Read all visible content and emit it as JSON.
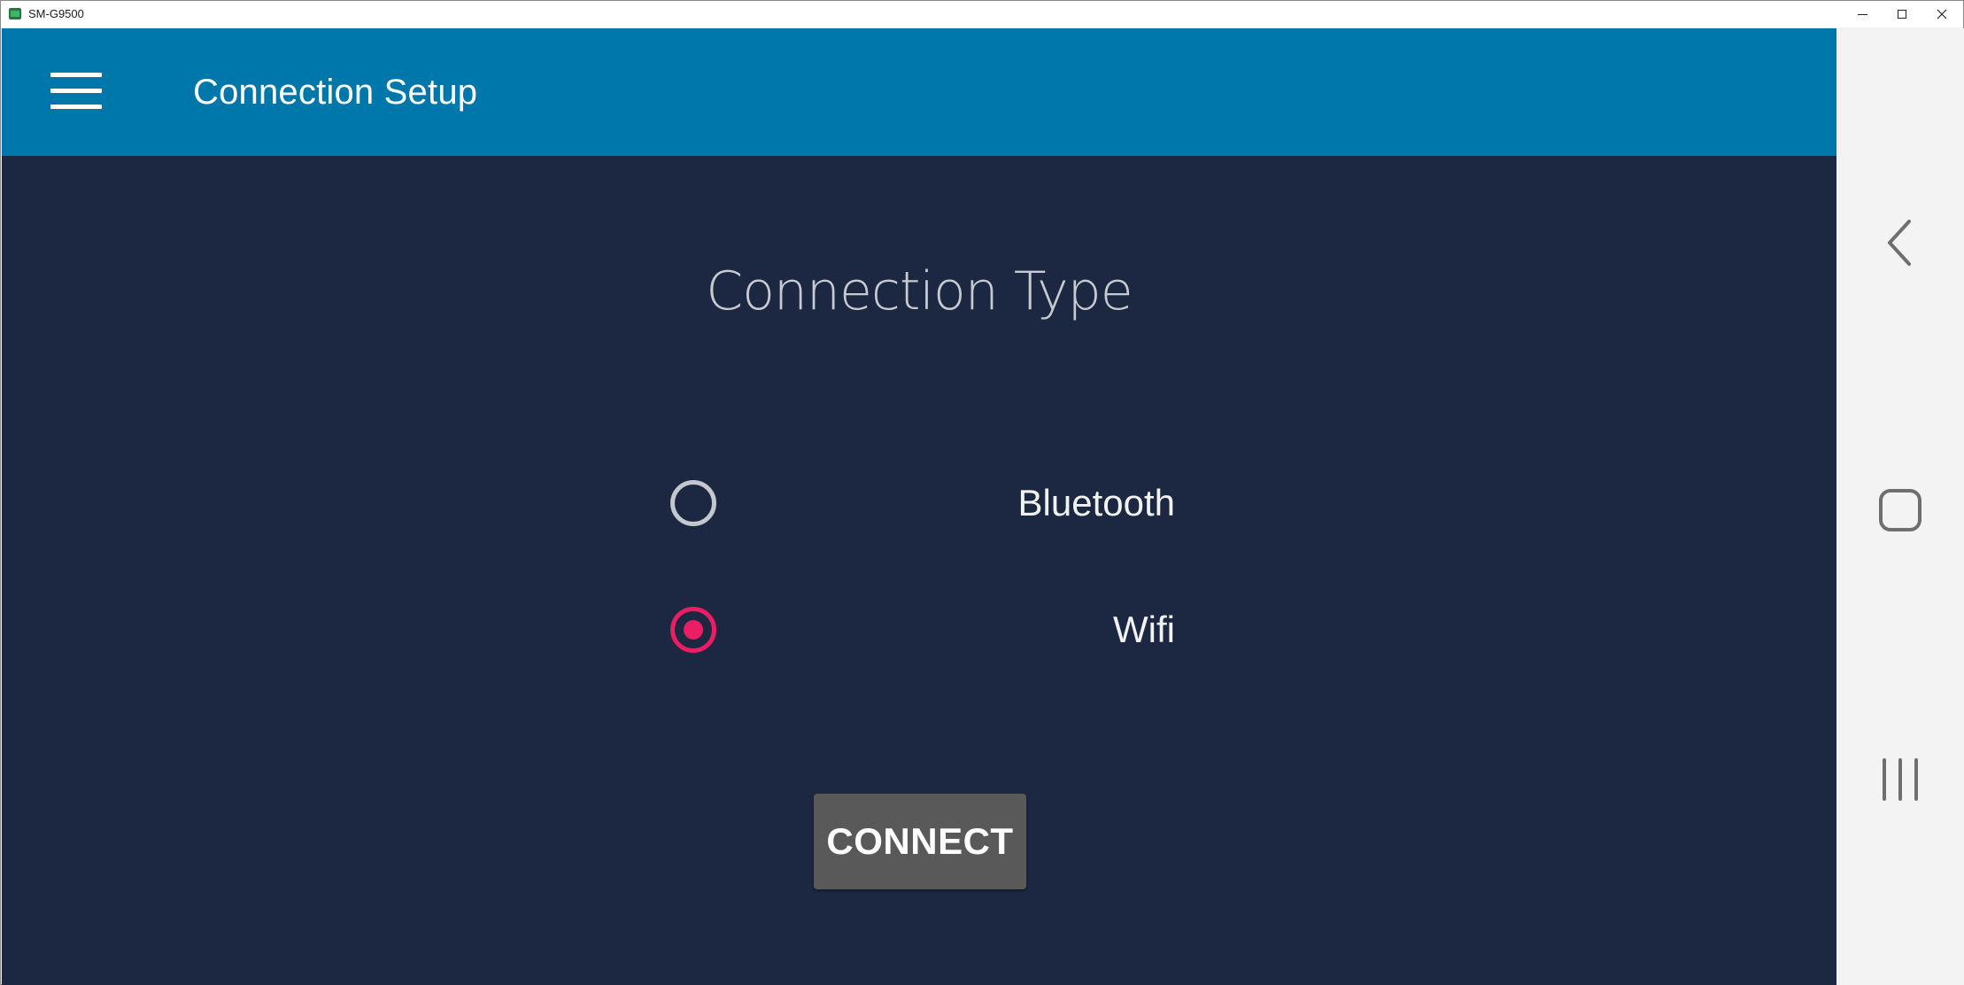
{
  "window": {
    "title": "SM-G9500"
  },
  "appbar": {
    "title": "Connection Setup",
    "menu_icon": "hamburger-menu-icon"
  },
  "content": {
    "section_title": "Connection Type",
    "options": [
      {
        "label": "Bluetooth",
        "checked": false
      },
      {
        "label": "Wifi",
        "checked": true
      }
    ],
    "connect_label": "CONNECT"
  },
  "navbar": {
    "icons": [
      "back-icon",
      "home-icon",
      "recent-apps-icon"
    ]
  },
  "colors": {
    "appbar": "#0077ab",
    "background": "#1c2841",
    "accent": "#e91e63",
    "button": "#595959"
  }
}
